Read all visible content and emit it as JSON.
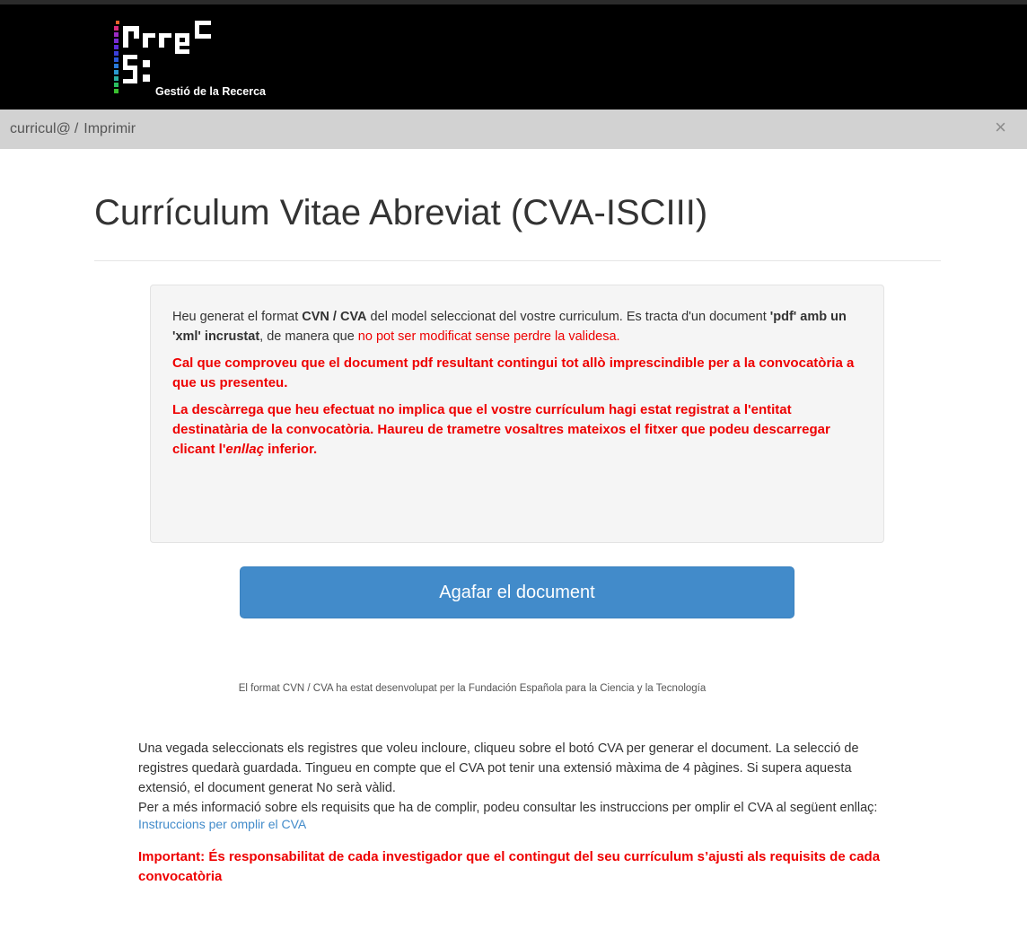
{
  "header": {
    "logo_subtitle": "Gestió de la Recerca"
  },
  "breadcrumb": {
    "root": "curricul@",
    "separator": "/",
    "current": "Imprimir",
    "close_glyph": "×"
  },
  "main": {
    "title": "Currículum Vitae Abreviat (CVA-ISCIII)"
  },
  "notice": {
    "p1_text_1": "Heu generat el format ",
    "p1_bold_1": "CVN / CVA",
    "p1_text_2": " del model seleccionat del vostre curriculum. Es tracta d'un document ",
    "p1_bold_2": "'pdf' amb un 'xml' incrustat",
    "p1_text_3": ", de manera que ",
    "p1_red": "no pot ser modificat sense perdre la validesa.",
    "warning_1": "Cal que comproveu que el document pdf resultant contingui tot allò imprescindible per a la convocatòria a que us presenteu.",
    "warning_2_before": "La descàrrega que heu efectuat no implica que el vostre currículum hagi estat registrat a l'entitat destinatària de la convocatòria. Haureu de trametre vosaltres mateixos el fitxer que podeu descarregar clicant l'",
    "warning_2_italic": "enllaç",
    "warning_2_after": " inferior."
  },
  "download_button": {
    "label": "Agafar el document"
  },
  "credit": "El format CVN / CVA ha estat desenvolupat per la Fundación Española para la Ciencia y la Tecnología",
  "info": {
    "line_1": "Una vegada seleccionats els registres que voleu incloure, cliqueu sobre el botó CVA per generar el document. La selecció de registres quedarà guardada. Tingueu en compte que el CVA pot tenir una extensió màxima de 4 pàgines. Si supera aquesta extensió, el document generat No serà vàlid.",
    "line_2": "Per a més informació sobre els requisits que ha de complir, podeu consultar les instruccions per omplir el CVA al següent enllaç:"
  },
  "instructions_link": "Instruccions per omplir el CVA",
  "important": "Important: És responsabilitat de cada investigador que el contingut del seu currículum s’ajusti als requisits de cada convocatòria",
  "colors": {
    "header_bg": "#000000",
    "breadcrumb_bg": "#d2d2d2",
    "notice_bg": "#f5f5f5",
    "warning_red": "#ee0000",
    "button_blue": "#428bca",
    "link_blue": "#428bca"
  }
}
